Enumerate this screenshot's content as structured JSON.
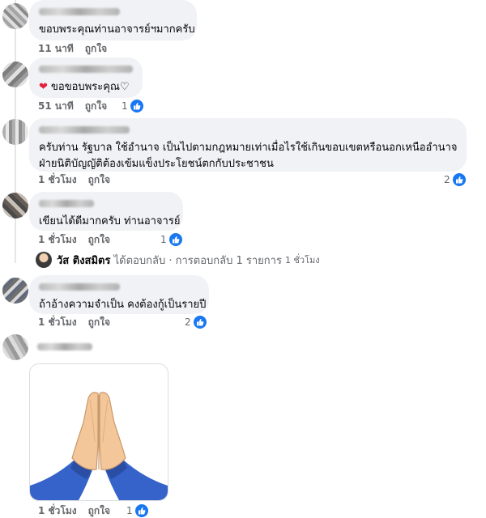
{
  "comments": [
    {
      "text": "ขอบพระคุณท่านอาจารย์ฯมากครับ",
      "time": "11 นาที",
      "like_label": "ถูกใจ",
      "reactions": ""
    },
    {
      "text": "ขอขอบพระคุณ♡",
      "emoji": "red-heart",
      "time": "51 นาที",
      "like_label": "ถูกใจ",
      "reactions": "1"
    },
    {
      "text_line1": "ครับท่าน รัฐบาล ใช้อำนาจ เป็นไปตามกฎหมายเท่าเมื่อไรใช้เกินขอบเขตหรือนอกเหนืออำนาจ",
      "text_line2": "ฝ่ายนิติบัญญัติต้องเข้มแข็งประโยชน์ตกกับประชาชน",
      "time": "1 ชั่วโมง",
      "like_label": "ถูกใจ",
      "reactions": "2"
    },
    {
      "text": "เขียนได้ดีมากครับ ท่านอาจารย์",
      "time": "1 ชั่วโมง",
      "like_label": "ถูกใจ",
      "reactions": "1"
    },
    {
      "text": "ถ้าอ้างความจำเป็น คงต้องกู้เป็นรายปี",
      "time": "1 ชั่วโมง",
      "like_label": "ถูกใจ",
      "reactions": "2"
    },
    {
      "image": "folded-hands-emoji",
      "time": "1 ชั่วโมง",
      "like_label": "ถูกใจ",
      "reactions": "1"
    }
  ],
  "reply_summary": {
    "name": "วัส ติงสมิตร",
    "text": "ได้ตอบกลับ · การตอบกลับ 1 รายการ",
    "time": "1 ชั่วโมง"
  },
  "colors": {
    "bubble": "#f0f2f5",
    "meta": "#65676b",
    "like_blue": "#1877f2",
    "heart": "#e41e3f"
  }
}
